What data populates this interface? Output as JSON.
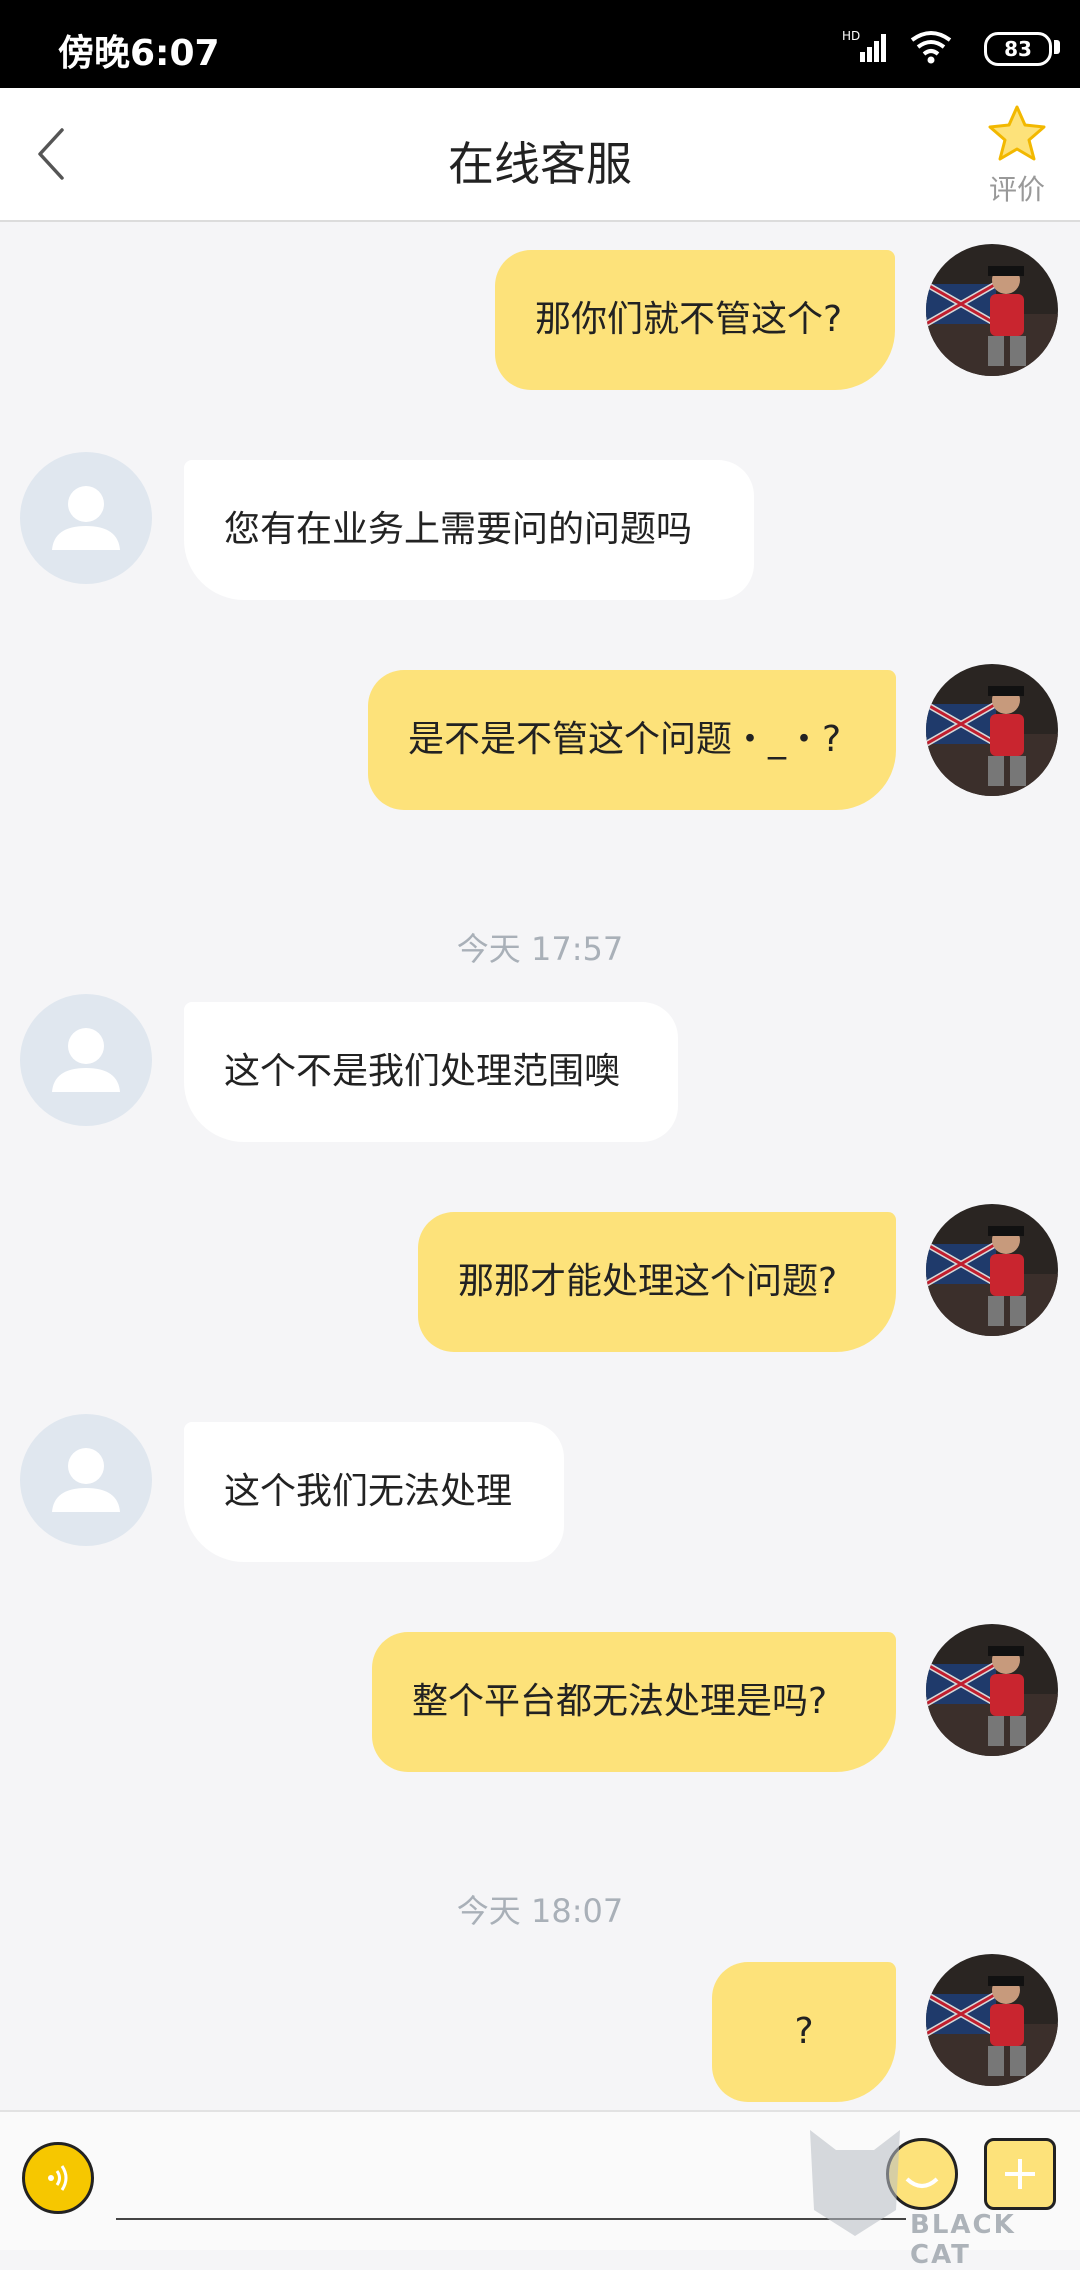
{
  "status_bar": {
    "time": "傍晚6:07",
    "network": "HD",
    "battery": "83"
  },
  "header": {
    "title": "在线客服",
    "rate_label": "评价"
  },
  "messages": [
    {
      "side": "me",
      "text": "那你们就不管这个?"
    },
    {
      "side": "them",
      "text": "您有在业务上需要问的问题吗"
    },
    {
      "side": "me",
      "text": "是不是不管这个问题・_・?"
    },
    {
      "side": "time",
      "text": "今天 17:57"
    },
    {
      "side": "them",
      "text": "这个不是我们处理范围噢"
    },
    {
      "side": "me",
      "text": "那那才能处理这个问题?"
    },
    {
      "side": "them",
      "text": "这个我们无法处理"
    },
    {
      "side": "me",
      "text": "整个平台都无法处理是吗?"
    },
    {
      "side": "time",
      "text": "今天 18:07"
    },
    {
      "side": "me",
      "text": "?"
    }
  ],
  "watermark": "BLACK CAT",
  "colors": {
    "my_bubble": "#fde27a",
    "their_bubble": "#ffffff",
    "accent": "#f6c700"
  }
}
